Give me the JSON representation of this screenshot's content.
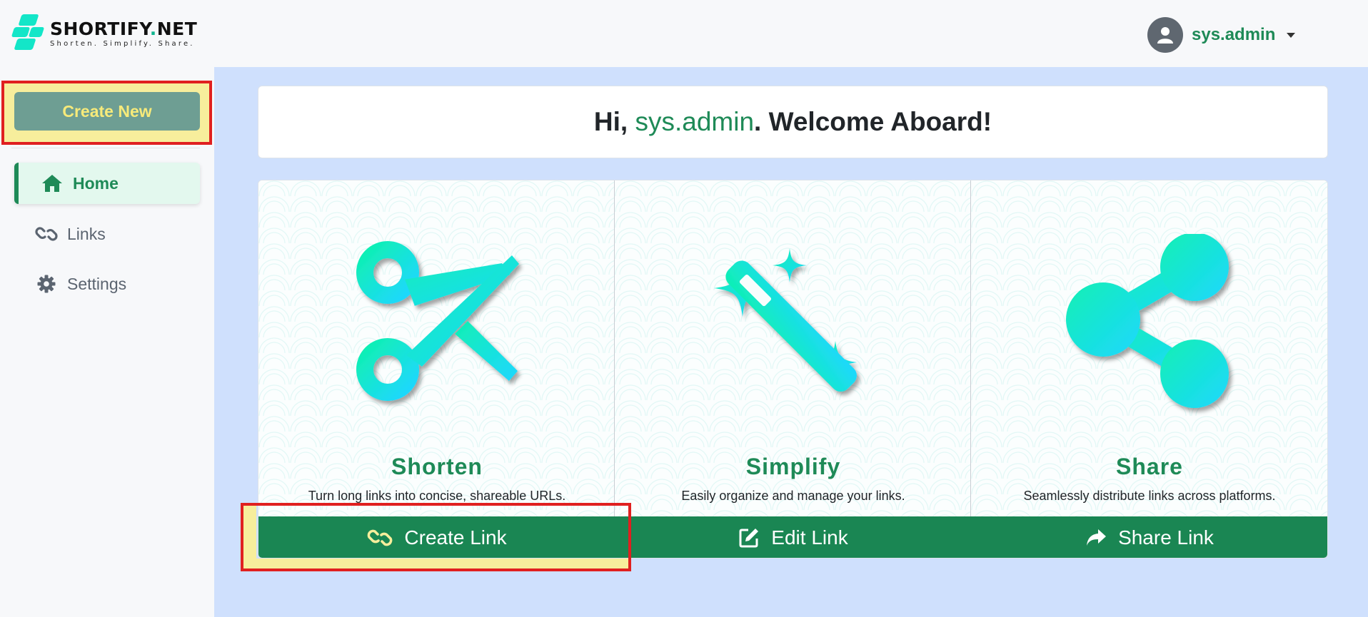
{
  "brand": {
    "name_main": "SHORTIFY",
    "name_dot": ".",
    "name_tld": "NET",
    "tagline": "Shorten. Simplify. Share."
  },
  "user": {
    "name": "sys.admin",
    "avatar_icon": "user-icon"
  },
  "sidebar": {
    "create_label": "Create New",
    "items": [
      {
        "label": "Home",
        "icon": "home-icon",
        "active": true
      },
      {
        "label": "Links",
        "icon": "link-icon",
        "active": false
      },
      {
        "label": "Settings",
        "icon": "gear-icon",
        "active": false
      }
    ]
  },
  "welcome": {
    "prefix": "Hi, ",
    "username": "sys.admin",
    "suffix": ". Welcome Aboard!"
  },
  "cards": [
    {
      "title": "Shorten",
      "description": "Turn long links into concise, shareable URLs.",
      "button": "Create Link",
      "art_icon": "scissors-icon",
      "button_icon": "link-icon"
    },
    {
      "title": "Simplify",
      "description": "Easily organize and manage your links.",
      "button": "Edit Link",
      "art_icon": "magic-wand-icon",
      "button_icon": "edit-icon"
    },
    {
      "title": "Share",
      "description": "Seamlessly distribute links across platforms.",
      "button": "Share Link",
      "art_icon": "share-icon",
      "button_icon": "share-arrow-icon"
    }
  ],
  "colors": {
    "accent": "#1e8a57",
    "main_bg": "#cfe0fd",
    "icon_gradient_start": "#0ff0b3",
    "icon_gradient_end": "#1fd7ff",
    "highlight": "#f7ee9c",
    "highlight_border": "#e02020"
  }
}
